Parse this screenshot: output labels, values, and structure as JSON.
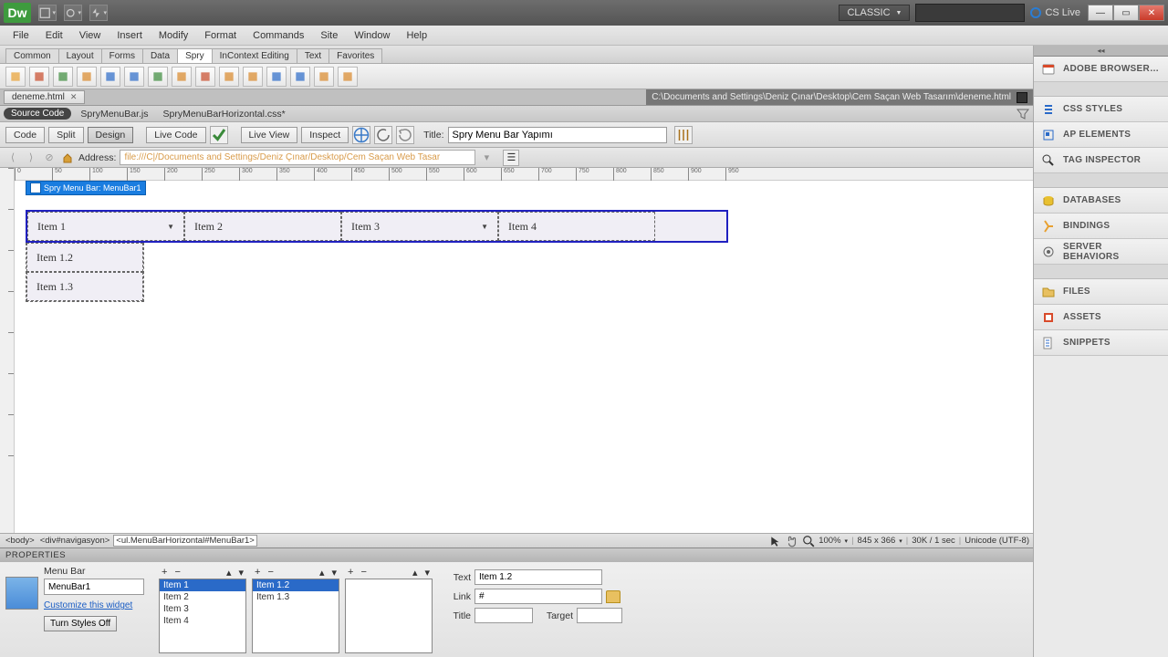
{
  "titlebar": {
    "logo": "Dw",
    "workspace": "CLASSIC",
    "cslive": "CS Live"
  },
  "menubar": [
    "File",
    "Edit",
    "View",
    "Insert",
    "Modify",
    "Format",
    "Commands",
    "Site",
    "Window",
    "Help"
  ],
  "insert_tabs": [
    "Common",
    "Layout",
    "Forms",
    "Data",
    "Spry",
    "InContext Editing",
    "Text",
    "Favorites"
  ],
  "insert_active": "Spry",
  "doc": {
    "tab": "deneme.html",
    "path": "C:\\Documents and Settings\\Deniz Çınar\\Desktop\\Cem Saçan Web Tasarım\\deneme.html"
  },
  "related": {
    "source": "Source Code",
    "files": [
      "SpryMenuBar.js",
      "SpryMenuBarHorizontal.css*"
    ]
  },
  "viewbar": {
    "code": "Code",
    "split": "Split",
    "design": "Design",
    "livecode": "Live Code",
    "liveview": "Live View",
    "inspect": "Inspect",
    "title_label": "Title:",
    "title_value": "Spry Menu Bar Yapımı"
  },
  "address": {
    "label": "Address:",
    "value": "file:///C|/Documents and Settings/Deniz Çınar/Desktop/Cem Saçan Web Tasar"
  },
  "ruler_marks": [
    0,
    50,
    100,
    150,
    200,
    250,
    300,
    350,
    400,
    450,
    500,
    550,
    600,
    650,
    700,
    750,
    800,
    850,
    900,
    950
  ],
  "spry_widget": {
    "tag": "Spry Menu Bar: MenuBar1",
    "top": [
      "Item 1",
      "Item 2",
      "Item 3",
      "Item 4"
    ],
    "has_dd": [
      true,
      false,
      true,
      false
    ],
    "sub": [
      "Item 1.2",
      "Item 1.3"
    ]
  },
  "status": {
    "tags": [
      "<body>",
      "<div#navigasyon>",
      "<ul.MenuBarHorizontal#MenuBar1>"
    ],
    "zoom": "100%",
    "dims": "845 x 366",
    "size": "30K / 1 sec",
    "enc": "Unicode (UTF-8)"
  },
  "props": {
    "header": "PROPERTIES",
    "kind": "Menu Bar",
    "name": "MenuBar1",
    "customize": "Customize this widget",
    "turnoff": "Turn Styles Off",
    "list1": [
      "Item 1",
      "Item 2",
      "Item 3",
      "Item 4"
    ],
    "list2": [
      "Item 1.2",
      "Item 1.3"
    ],
    "text_label": "Text",
    "text_value": "Item 1.2",
    "link_label": "Link",
    "link_value": "#",
    "title_label": "Title",
    "title_value": "",
    "target_label": "Target",
    "target_value": ""
  },
  "panels": [
    "ADOBE BROWSER…",
    "CSS STYLES",
    "AP ELEMENTS",
    "TAG INSPECTOR",
    "DATABASES",
    "BINDINGS",
    "SERVER BEHAVIORS",
    "FILES",
    "ASSETS",
    "SNIPPETS"
  ]
}
